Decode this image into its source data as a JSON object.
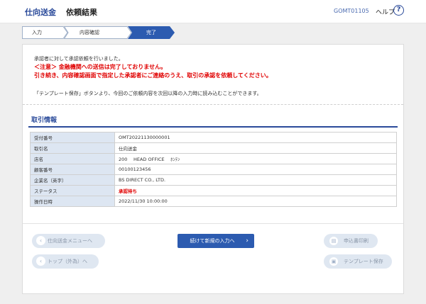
{
  "header": {
    "title": "仕向送金",
    "subtitle": "依頼結果",
    "screen_code": "GOMT01105",
    "help_label": "ヘルプ",
    "help_icon": "question-icon"
  },
  "steps": [
    {
      "label": "入力",
      "state": "done"
    },
    {
      "label": "内容確認",
      "state": "done"
    },
    {
      "label": "完了",
      "state": "current"
    }
  ],
  "messages": {
    "info": "承認者に対して承認依頼を行いました。",
    "warning_line1": "＜注意＞ 金融機関への送信は完了しておりません。",
    "warning_line2": "引き続き、内容確認画面で指定した承認者にご連絡のうえ、取引の承認を依頼してください。",
    "template_note": "「テンプレート保存」ボタンより、今回のご依頼内容を次回以降の入力時に読み込むことができます。"
  },
  "section": {
    "title": "取引情報"
  },
  "transaction": [
    {
      "label": "受付番号",
      "value": "OMT20221130000001"
    },
    {
      "label": "取引名",
      "value": "仕向送金"
    },
    {
      "label": "店名",
      "value": "200　 HEAD OFFICE　 ﾎﾝﾃﾝ"
    },
    {
      "label": "顧客番号",
      "value": "00100123456"
    },
    {
      "label": "企業名（英字）",
      "value": "BS DIRECT CO., LTD."
    },
    {
      "label": "ステータス",
      "value": "承認待ち"
    },
    {
      "label": "操作日時",
      "value": "2022/11/30 10:00:00"
    }
  ],
  "buttons": {
    "menu": "仕向送金メニューへ",
    "top": "トップ（外為）へ",
    "continue": "続けて新規の入力へ",
    "print": "申込書印刷",
    "template_save": "テンプレート保存"
  },
  "colors": {
    "brand": "#2a4a9a",
    "primary_button": "#2c5bb0",
    "warning": "#e00000",
    "table_label_bg": "#dde6f2",
    "step_current": "#2c5bb0"
  }
}
